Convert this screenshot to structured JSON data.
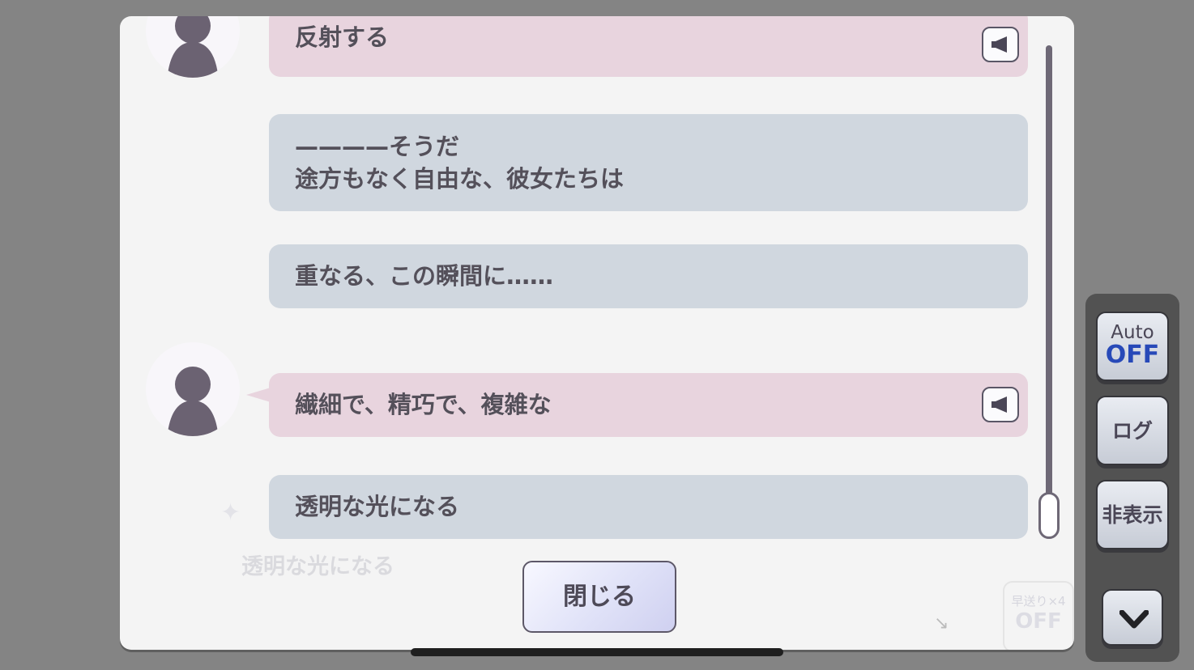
{
  "log": {
    "entries": [
      {
        "type": "speech",
        "text": "反射する",
        "has_voice": true
      },
      {
        "type": "narration",
        "text": "————そうだ\n途方もなく自由な、彼女たちは",
        "has_voice": false
      },
      {
        "type": "narration",
        "text": "重なる、この瞬間に……",
        "has_voice": false
      },
      {
        "type": "speech",
        "text": "繊細で、精巧で、複雑な",
        "has_voice": true
      },
      {
        "type": "narration",
        "text": "透明な光になる",
        "has_voice": false
      }
    ],
    "close_label": "閉じる"
  },
  "background_text": {
    "text": "透明な光になる",
    "fast_label": "早送り×4",
    "fast_state": "OFF"
  },
  "side_panel": {
    "auto_label": "Auto",
    "auto_state": "OFF",
    "log_label": "ログ",
    "hide_label": "非表示"
  },
  "colors": {
    "speech_bubble": "#e8d4de",
    "narration_bubble": "#d0d7df",
    "auto_off": "#2749b8"
  }
}
